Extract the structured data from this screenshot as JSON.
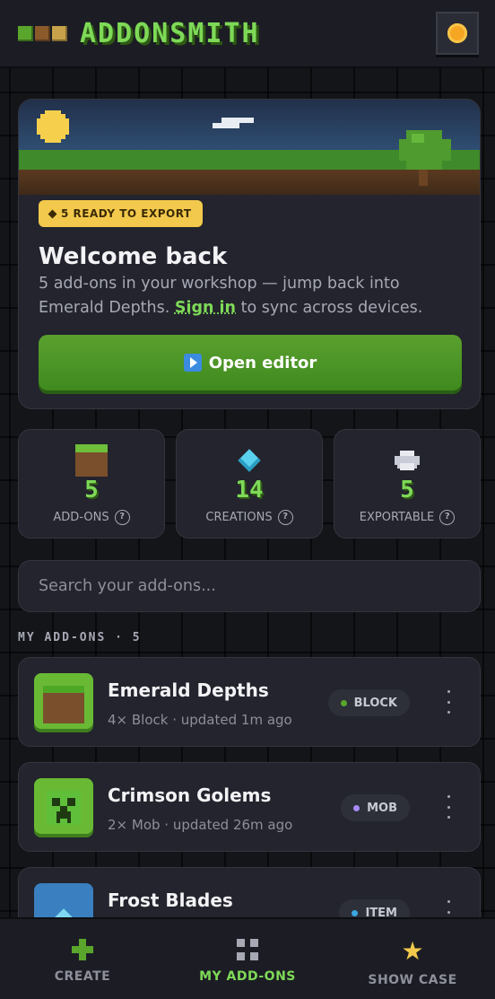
{
  "app": {
    "title": "ADDONSMITH"
  },
  "hero": {
    "badge": "5 READY TO EXPORT",
    "title": "Welcome back",
    "text_before": "5 add-ons in your workshop — jump back into Emerald Depths. ",
    "sign_in": "Sign in",
    "text_after": " to sync across devices.",
    "button_label": "Open editor"
  },
  "stats": [
    {
      "icon": "grass-block-icon",
      "value": "5",
      "label": "ADD-ONS"
    },
    {
      "icon": "diamond-icon",
      "value": "14",
      "label": "CREATIONS"
    },
    {
      "icon": "printer-icon",
      "value": "5",
      "label": "EXPORTABLE"
    }
  ],
  "search": {
    "placeholder": "Search your add-ons..."
  },
  "section": {
    "title": "MY ADD-ONS · 5"
  },
  "addons": [
    {
      "name": "Emerald Depths",
      "meta": "4× Block · updated 1m ago",
      "tag": "BLOCK",
      "tag_color": "#5aa62c"
    },
    {
      "name": "Crimson Golems",
      "meta": "2× Mob · updated 26m ago",
      "tag": "MOB",
      "tag_color": "#a78bfa"
    },
    {
      "name": "Frost Blades",
      "meta": "",
      "tag": "ITEM",
      "tag_color": "#3ba7e0"
    }
  ],
  "nav": [
    {
      "label": "CREATE",
      "icon": "plus-icon",
      "active": false
    },
    {
      "label": "MY ADD-ONS",
      "icon": "grid-icon",
      "active": true
    },
    {
      "label": "SHOW CASE",
      "icon": "star-icon",
      "active": false
    }
  ],
  "colors": {
    "accent": "#7ed957",
    "button": "#4a9a26",
    "badge": "#f2c94c",
    "background": "#141519",
    "card": "#23242d"
  }
}
